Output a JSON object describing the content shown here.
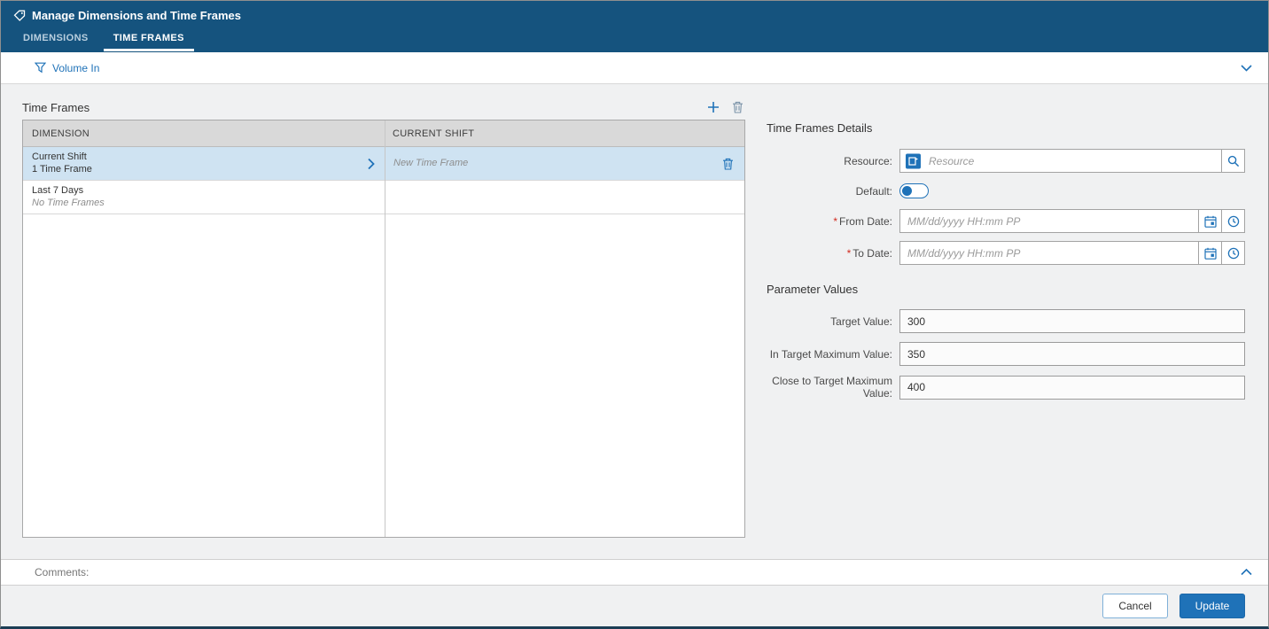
{
  "colors": {
    "header_bg": "#15537e",
    "accent": "#1f72b8",
    "selected_row": "#cfe3f2",
    "required_marker_color": "#d12b1f"
  },
  "header": {
    "title": "Manage Dimensions and Time Frames",
    "tabs": [
      {
        "label": "DIMENSIONS",
        "active": false
      },
      {
        "label": "TIME FRAMES",
        "active": true
      }
    ]
  },
  "filter_bar": {
    "label": "Volume In"
  },
  "time_frames_panel": {
    "title": "Time Frames",
    "columns": [
      "DIMENSION",
      "CURRENT SHIFT"
    ],
    "rows": [
      {
        "name": "Current Shift",
        "summary": "1 Time Frame",
        "time_frame": "New Time Frame",
        "selected": true
      },
      {
        "name": "Last 7 Days",
        "summary": "No Time Frames",
        "time_frame": "",
        "selected": false
      }
    ]
  },
  "details_panel": {
    "title": "Time Frames Details",
    "required_marker": "*",
    "resource_label": "Resource:",
    "resource_placeholder": "Resource",
    "default_label": "Default:",
    "default_on": false,
    "from_date_label": "From Date:",
    "to_date_label": "To Date:",
    "date_placeholder": "MM/dd/yyyy HH:mm PP",
    "parameter_values": {
      "title": "Parameter Values",
      "fields": [
        {
          "label": "Target Value:",
          "value": "300"
        },
        {
          "label": "In Target Maximum Value:",
          "value": "350"
        },
        {
          "label": "Close to Target Maximum Value:",
          "value": "400"
        }
      ]
    }
  },
  "comments": {
    "label": "Comments:"
  },
  "footer": {
    "cancel_label": "Cancel",
    "update_label": "Update"
  }
}
